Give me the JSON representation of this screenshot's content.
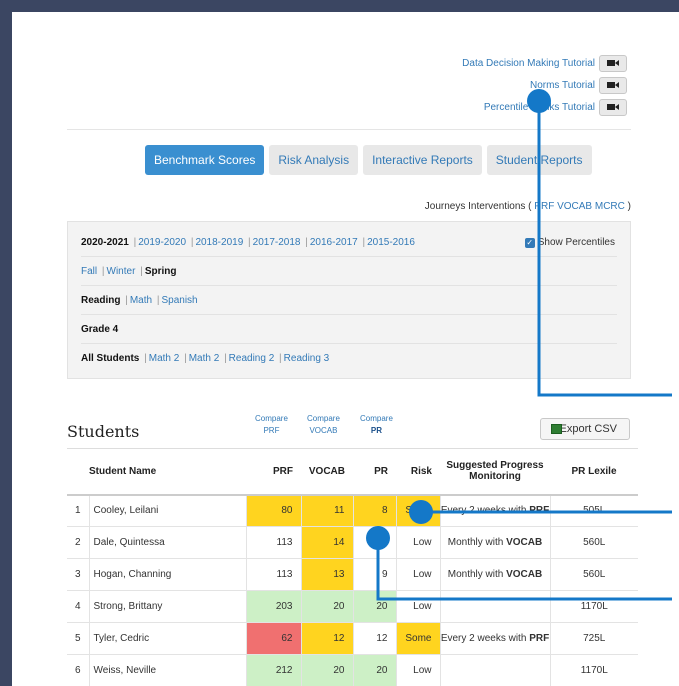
{
  "tutorials": [
    {
      "label": "Data Decision Making Tutorial"
    },
    {
      "label": "Norms Tutorial"
    },
    {
      "label": "Percentile Ranks Tutorial"
    }
  ],
  "tabs": [
    "Benchmark Scores",
    "Risk Analysis",
    "Interactive Reports",
    "Student Reports"
  ],
  "journeys": {
    "prefix": "Journeys Interventions (",
    "links": [
      "PRF",
      "VOCAB",
      "MCRC"
    ],
    "suffix": ")"
  },
  "filters": {
    "years_selected": "2020-2021",
    "years": [
      "2019-2020",
      "2018-2019",
      "2017-2018",
      "2016-2017",
      "2015-2016"
    ],
    "show_percentiles": "Show Percentiles",
    "seasons": [
      "Fall",
      "Winter"
    ],
    "season_selected": "Spring",
    "subject_selected": "Reading",
    "subjects": [
      "Math",
      "Spanish"
    ],
    "grade": "Grade 4",
    "group_selected": "All Students",
    "groups": [
      "Math 2",
      "Math 2",
      "Reading 2",
      "Reading 3"
    ]
  },
  "students_title": "Students",
  "compare": [
    {
      "line1": "Compare",
      "line2": "PRF"
    },
    {
      "line1": "Compare",
      "line2": "VOCAB"
    },
    {
      "line1": "Compare",
      "line2": "PR"
    }
  ],
  "export_label": "Export CSV",
  "columns": [
    "Student Name",
    "PRF",
    "VOCAB",
    "PR",
    "Risk",
    "Suggested Progress Monitoring",
    "PR Lexile"
  ],
  "rows": [
    {
      "n": "1",
      "name": "Cooley, Leilani",
      "prf": "80",
      "vocab": "11",
      "pr": "8",
      "risk": "Some",
      "mon_pre": "Every 2 weeks with ",
      "mon_b": "PRF",
      "lexile": "505L"
    },
    {
      "n": "2",
      "name": "Dale, Quintessa",
      "prf": "113",
      "vocab": "14",
      "pr": "9",
      "risk": "Low",
      "mon_pre": "Monthly with ",
      "mon_b": "VOCAB",
      "lexile": "560L"
    },
    {
      "n": "3",
      "name": "Hogan, Channing",
      "prf": "113",
      "vocab": "13",
      "pr": "9",
      "risk": "Low",
      "mon_pre": "Monthly with ",
      "mon_b": "VOCAB",
      "lexile": "560L"
    },
    {
      "n": "4",
      "name": "Strong, Brittany",
      "prf": "203",
      "vocab": "20",
      "pr": "20",
      "risk": "Low",
      "mon_pre": "",
      "mon_b": "",
      "lexile": "1170L"
    },
    {
      "n": "5",
      "name": "Tyler, Cedric",
      "prf": "62",
      "vocab": "12",
      "pr": "12",
      "risk": "Some",
      "mon_pre": "Every 2 weeks with ",
      "mon_b": "PRF",
      "lexile": "725L"
    },
    {
      "n": "6",
      "name": "Weiss, Neville",
      "prf": "212",
      "vocab": "20",
      "pr": "20",
      "risk": "Low",
      "mon_pre": "",
      "mon_b": "",
      "lexile": "1170L"
    }
  ],
  "colors": {
    "accent": "#3a8fd0",
    "yellow": "#ffd41f",
    "green": "#cdf0c6",
    "red": "#f07070",
    "callout": "#1478c8",
    "frame": "#3b4662"
  }
}
